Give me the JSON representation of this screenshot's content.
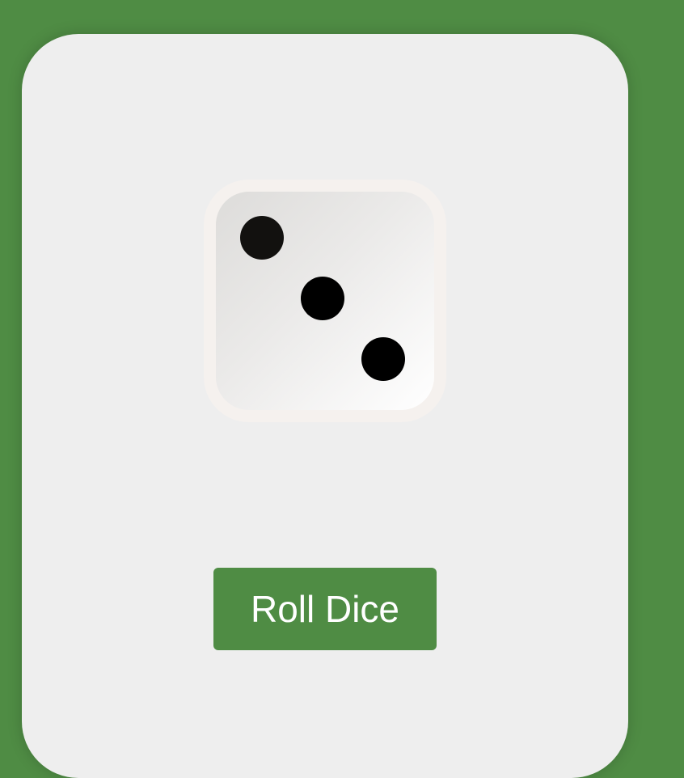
{
  "theme": {
    "background": "#4f8c44",
    "card": "#eeeeee",
    "die_border": "#f5f1ee",
    "pip": "#000000",
    "button_bg": "#4f8c44",
    "button_text": "#ffffff"
  },
  "die": {
    "face_value": 3,
    "icon": "dice-three-icon"
  },
  "controls": {
    "roll_label": "Roll Dice"
  }
}
